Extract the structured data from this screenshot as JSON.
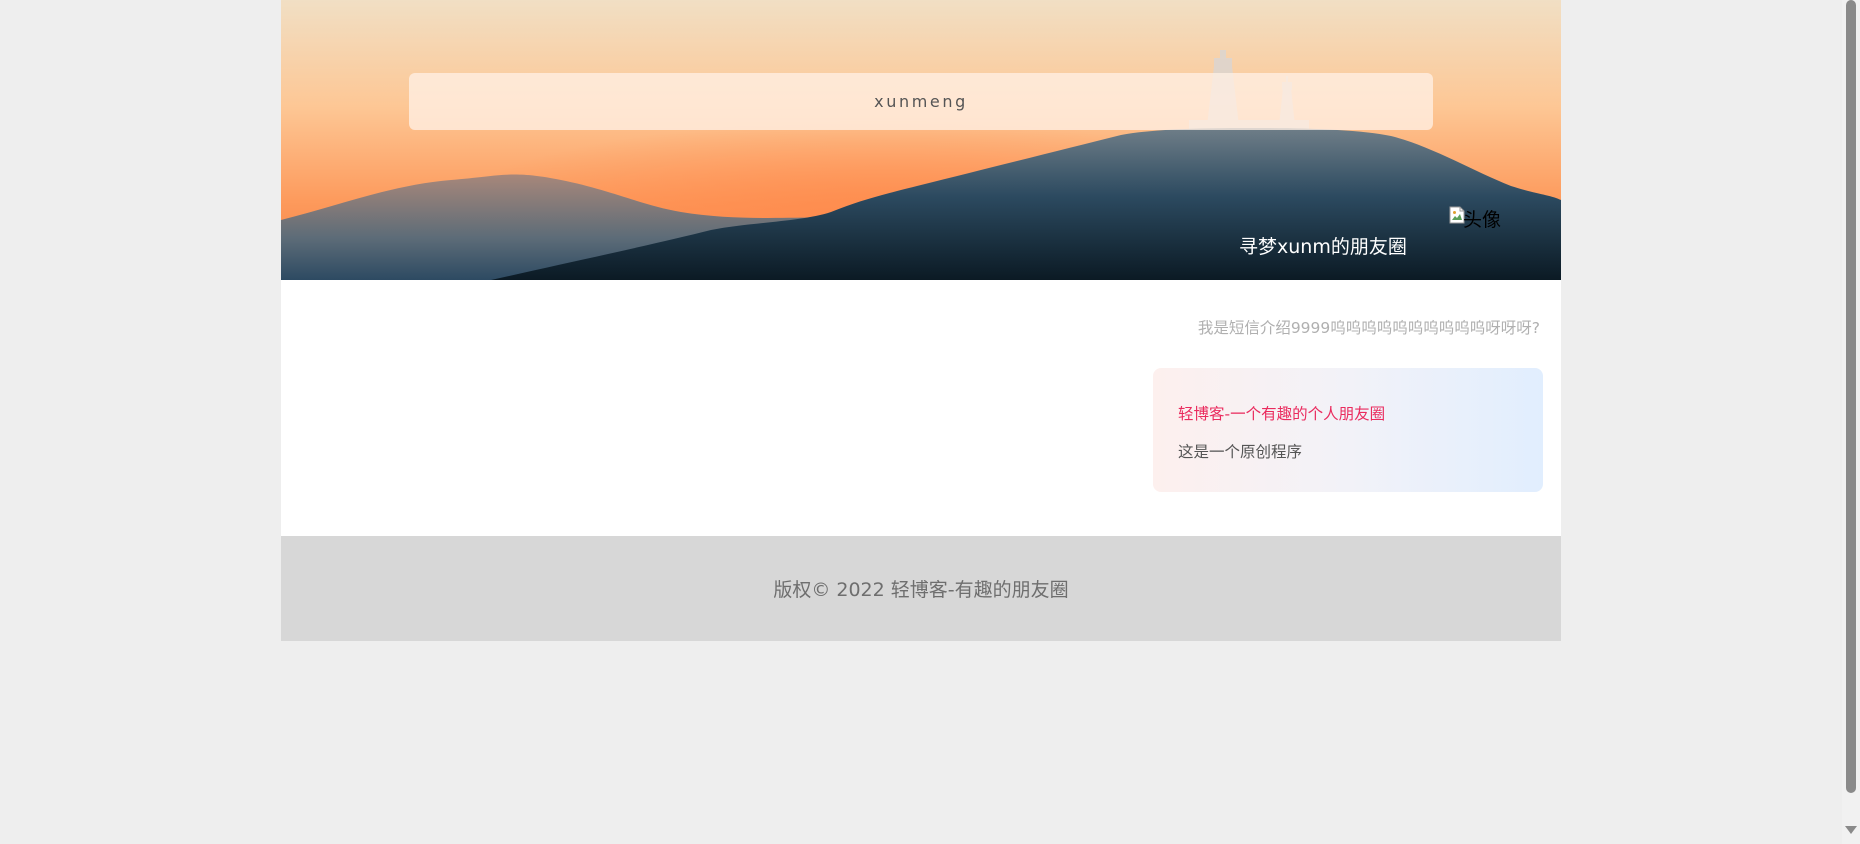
{
  "header": {
    "site_title": "xunmeng",
    "nickname": "寻梦xunm的朋友圈",
    "avatar_alt": "头像"
  },
  "profile": {
    "intro": "我是短信介绍9999呜呜呜呜呜呜呜呜呜呜呀呀呀?"
  },
  "card": {
    "title": "轻博客-一个有趣的个人朋友圈",
    "description": "这是一个原创程序"
  },
  "footer": {
    "copyright": "版权© 2022 轻博客-有趣的朋友圈"
  },
  "colors": {
    "background": "#eeeeee",
    "card_title": "#ea2b5e",
    "footer_bg": "#d7d7d7"
  },
  "icons": {
    "avatar": "broken-image-icon",
    "scroll_down": "chevron-down-icon"
  }
}
